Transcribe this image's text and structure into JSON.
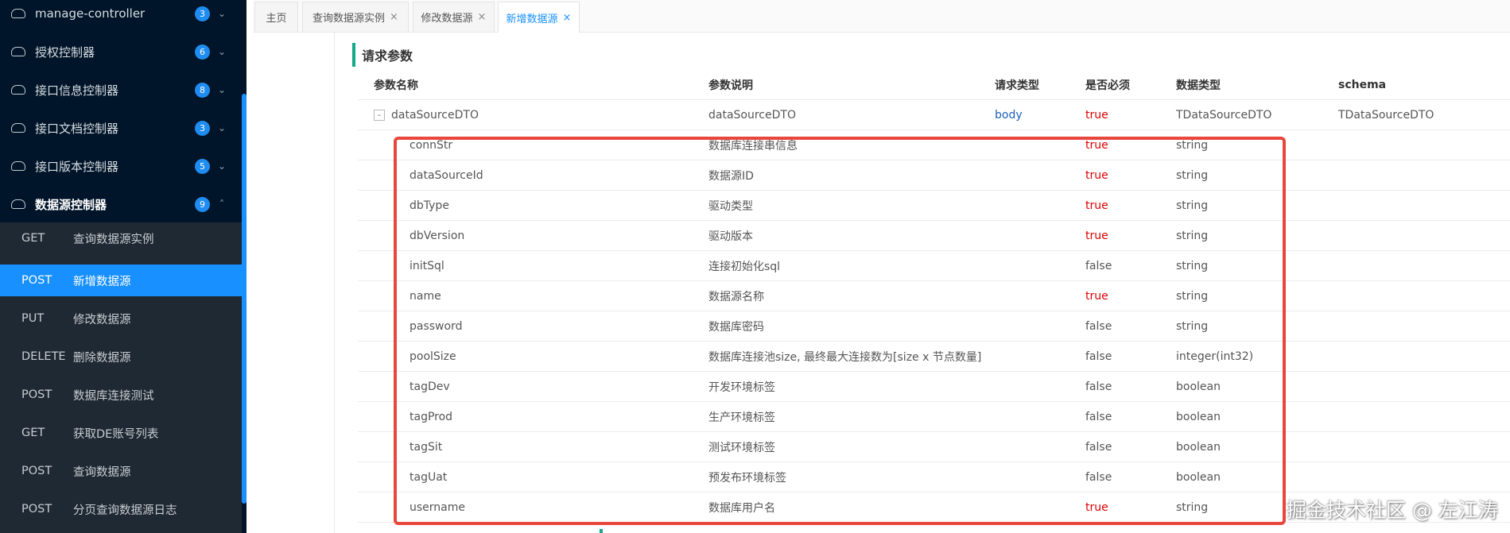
{
  "sidebar": {
    "groups": [
      {
        "label": "manage-controller",
        "count": "3",
        "chevron": "⌄"
      },
      {
        "label": "授权控制器",
        "count": "6",
        "chevron": "⌄"
      },
      {
        "label": "接口信息控制器",
        "count": "8",
        "chevron": "⌄"
      },
      {
        "label": "接口文档控制器",
        "count": "3",
        "chevron": "⌄"
      },
      {
        "label": "接口版本控制器",
        "count": "5",
        "chevron": "⌄"
      },
      {
        "label": "数据源控制器",
        "count": "9",
        "chevron": "˄"
      }
    ],
    "apis": [
      {
        "method": "GET",
        "label": "查询数据源实例"
      },
      {
        "method": "POST",
        "label": "新增数据源"
      },
      {
        "method": "PUT",
        "label": "修改数据源"
      },
      {
        "method": "DELETE",
        "label": "删除数据源"
      },
      {
        "method": "POST",
        "label": "数据库连接测试"
      },
      {
        "method": "GET",
        "label": "获取DE账号列表"
      },
      {
        "method": "POST",
        "label": "查询数据源"
      },
      {
        "method": "POST",
        "label": "分页查询数据源日志"
      }
    ]
  },
  "tabs": [
    {
      "label": "主页",
      "closable": false
    },
    {
      "label": "查询数据源实例",
      "closable": true
    },
    {
      "label": "修改数据源",
      "closable": true
    },
    {
      "label": "新增数据源",
      "closable": true
    }
  ],
  "close_glyph": "×",
  "section_title": "请求参数",
  "table": {
    "headers": [
      "参数名称",
      "参数说明",
      "请求类型",
      "是否必须",
      "数据类型",
      "schema"
    ],
    "parent": {
      "toggle": "-",
      "name": "dataSourceDTO",
      "desc": "dataSourceDTO",
      "in": "body",
      "required": "true",
      "type": "TDataSourceDTO",
      "schema": "TDataSourceDTO"
    },
    "rows": [
      {
        "name": "connStr",
        "desc": "数据库连接串信息",
        "required": "true",
        "type": "string"
      },
      {
        "name": "dataSourceId",
        "desc": "数据源ID",
        "required": "true",
        "type": "string"
      },
      {
        "name": "dbType",
        "desc": "驱动类型",
        "required": "true",
        "type": "string"
      },
      {
        "name": "dbVersion",
        "desc": "驱动版本",
        "required": "true",
        "type": "string"
      },
      {
        "name": "initSql",
        "desc": "连接初始化sql",
        "required": "false",
        "type": "string"
      },
      {
        "name": "name",
        "desc": "数据源名称",
        "required": "true",
        "type": "string"
      },
      {
        "name": "password",
        "desc": "数据库密码",
        "required": "false",
        "type": "string"
      },
      {
        "name": "poolSize",
        "desc": "数据库连接池size, 最终最大连接数为[size x 节点数量]",
        "required": "false",
        "type": "integer(int32)"
      },
      {
        "name": "tagDev",
        "desc": "开发环境标签",
        "required": "false",
        "type": "boolean"
      },
      {
        "name": "tagProd",
        "desc": "生产环境标签",
        "required": "false",
        "type": "boolean"
      },
      {
        "name": "tagSit",
        "desc": "测试环境标签",
        "required": "false",
        "type": "boolean"
      },
      {
        "name": "tagUat",
        "desc": "预发布环境标签",
        "required": "false",
        "type": "boolean"
      },
      {
        "name": "username",
        "desc": "数据库用户名",
        "required": "true",
        "type": "string"
      }
    ]
  },
  "watermark": "掘金技术社区 @ 左江涛",
  "colors": {
    "sidebar_bg": "#001529",
    "active_blue": "#1890ff",
    "required_red": "#e00000",
    "section_green": "#13a98a",
    "highlight_red": "#e8473d"
  }
}
